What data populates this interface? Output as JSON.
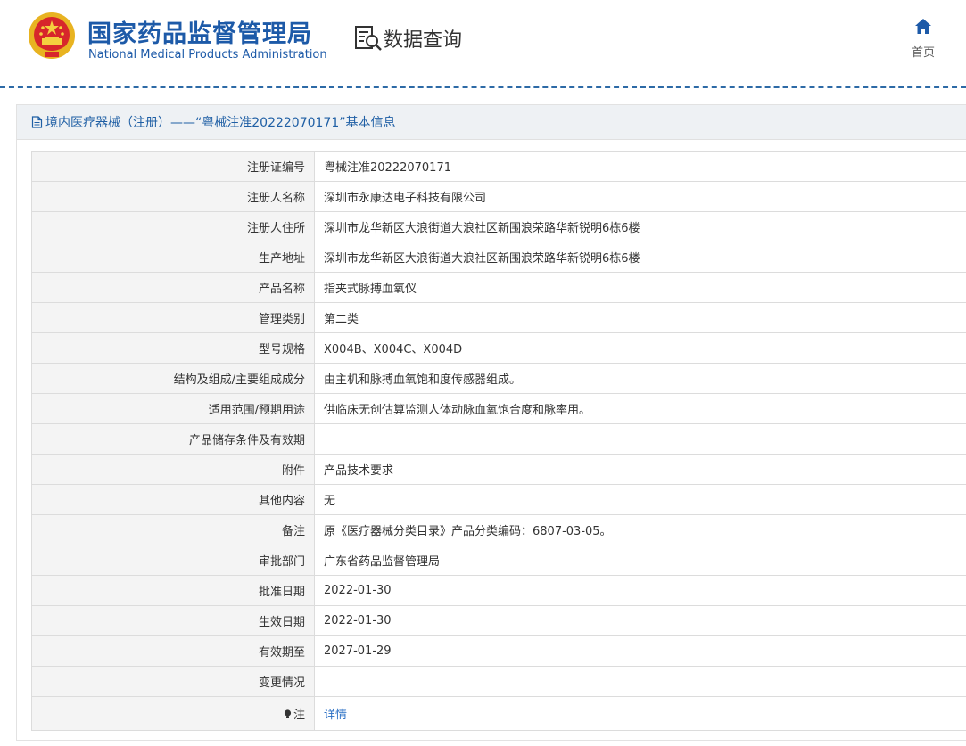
{
  "header": {
    "agency_name_cn": "国家药品监督管理局",
    "agency_name_en": "National Medical Products Administration",
    "page_title": "数据查询",
    "home_label": "首页",
    "brand_color": "#1d5aa8"
  },
  "panel": {
    "title": "境内医疗器械（注册）——“粤械注准20222070171”基本信息"
  },
  "rows": [
    {
      "label": "注册证编号",
      "value": "粤械注准20222070171"
    },
    {
      "label": "注册人名称",
      "value": "深圳市永康达电子科技有限公司"
    },
    {
      "label": "注册人住所",
      "value": "深圳市龙华新区大浪街道大浪社区新围浪荣路华新锐明6栋6楼"
    },
    {
      "label": "生产地址",
      "value": "深圳市龙华新区大浪街道大浪社区新围浪荣路华新锐明6栋6楼"
    },
    {
      "label": "产品名称",
      "value": "指夹式脉搏血氧仪"
    },
    {
      "label": "管理类别",
      "value": "第二类"
    },
    {
      "label": "型号规格",
      "value": "X004B、X004C、X004D"
    },
    {
      "label": "结构及组成/主要组成成分",
      "value": "由主机和脉搏血氧饱和度传感器组成。"
    },
    {
      "label": "适用范围/预期用途",
      "value": "供临床无创估算监测人体动脉血氧饱合度和脉率用。"
    },
    {
      "label": "产品储存条件及有效期",
      "value": ""
    },
    {
      "label": "附件",
      "value": "产品技术要求"
    },
    {
      "label": "其他内容",
      "value": "无"
    },
    {
      "label": "备注",
      "value": "原《医疗器械分类目录》产品分类编码：6807-03-05。"
    },
    {
      "label": "审批部门",
      "value": "广东省药品监督管理局"
    },
    {
      "label": "批准日期",
      "value": "2022-01-30"
    },
    {
      "label": "生效日期",
      "value": "2022-01-30"
    },
    {
      "label": "有效期至",
      "value": "2027-01-29"
    },
    {
      "label": "变更情况",
      "value": ""
    }
  ],
  "note": {
    "label": "注",
    "link_text": "详情",
    "icon": "lightbulb-icon"
  }
}
